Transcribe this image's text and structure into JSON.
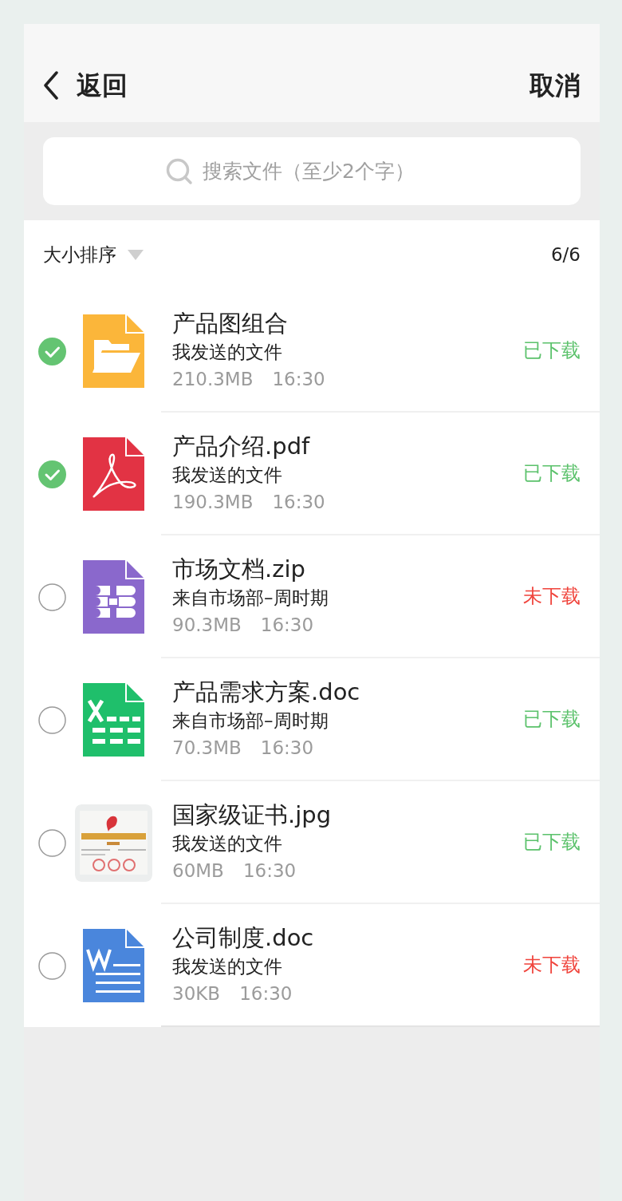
{
  "header": {
    "back_label": "返回",
    "cancel_label": "取消"
  },
  "search": {
    "placeholder": "搜索文件（至少2个字）"
  },
  "sort": {
    "label": "大小排序",
    "count": "6/6"
  },
  "files": [
    {
      "name": "产品图组合",
      "source": "我发送的文件",
      "size": "210.3MB",
      "time": "16:30",
      "status": "已下载",
      "downloaded": true,
      "checked": true,
      "kind": "folder"
    },
    {
      "name": "产品介绍.pdf",
      "source": "我发送的文件",
      "size": "190.3MB",
      "time": "16:30",
      "status": "已下载",
      "downloaded": true,
      "checked": true,
      "kind": "pdf"
    },
    {
      "name": "市场文档.zip",
      "source": "来自市场部–周时期",
      "size": "90.3MB",
      "time": "16:30",
      "status": "未下载",
      "downloaded": false,
      "checked": false,
      "kind": "zip"
    },
    {
      "name": "产品需求方案.doc",
      "source": "来自市场部–周时期",
      "size": "70.3MB",
      "time": "16:30",
      "status": "已下载",
      "downloaded": true,
      "checked": false,
      "kind": "sheet"
    },
    {
      "name": "国家级证书.jpg",
      "source": "我发送的文件",
      "size": "60MB",
      "time": "16:30",
      "status": "已下载",
      "downloaded": true,
      "checked": false,
      "kind": "picture"
    },
    {
      "name": "公司制度.doc",
      "source": "我发送的文件",
      "size": "30KB",
      "time": "16:30",
      "status": "未下载",
      "downloaded": false,
      "checked": false,
      "kind": "word"
    }
  ]
}
